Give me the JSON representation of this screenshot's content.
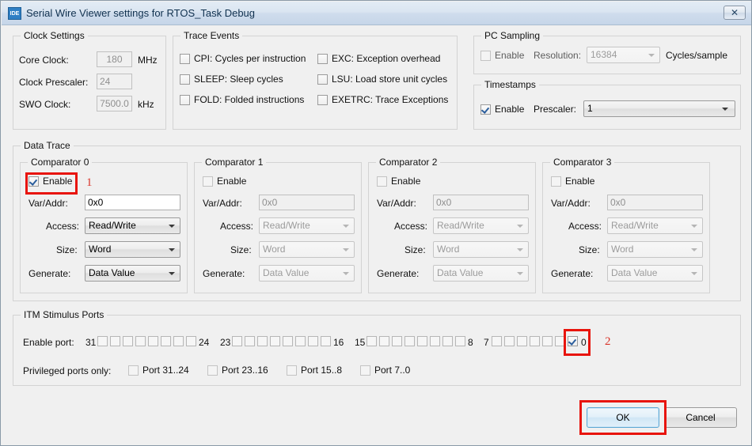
{
  "window": {
    "title": "Serial Wire Viewer settings for RTOS_Task Debug",
    "icon_label": "IDE",
    "close_glyph": "✕",
    "close_icon_name": "close-icon"
  },
  "clock_settings": {
    "title": "Clock Settings",
    "core_clock": {
      "label": "Core Clock:",
      "value": "180",
      "unit": "MHz"
    },
    "clock_prescaler": {
      "label": "Clock Prescaler:",
      "value": "24"
    },
    "swo_clock": {
      "label": "SWO Clock:",
      "value": "7500.0",
      "unit": "kHz"
    }
  },
  "trace_events": {
    "title": "Trace Events",
    "items": [
      {
        "label": "CPI: Cycles per instruction",
        "checked": false
      },
      {
        "label": "EXC: Exception overhead",
        "checked": false
      },
      {
        "label": "SLEEP: Sleep cycles",
        "checked": false
      },
      {
        "label": "LSU: Load store unit cycles",
        "checked": false
      },
      {
        "label": "FOLD: Folded instructions",
        "checked": false
      },
      {
        "label": "EXETRC: Trace Exceptions",
        "checked": false
      }
    ]
  },
  "pc_sampling": {
    "title": "PC Sampling",
    "enable_label": "Enable",
    "enabled": false,
    "resolution_label": "Resolution:",
    "resolution_value": "16384",
    "cycles_label": "Cycles/sample"
  },
  "timestamps": {
    "title": "Timestamps",
    "enable_label": "Enable",
    "enabled": true,
    "prescaler_label": "Prescaler:",
    "prescaler_value": "1"
  },
  "data_trace": {
    "title": "Data Trace",
    "field_labels": {
      "var_addr": "Var/Addr:",
      "access": "Access:",
      "size": "Size:",
      "generate": "Generate:",
      "enable": "Enable"
    },
    "comparators": [
      {
        "title": "Comparator 0",
        "enabled": true,
        "var_addr": "0x0",
        "access": "Read/Write",
        "size": "Word",
        "generate": "Data Value"
      },
      {
        "title": "Comparator 1",
        "enabled": false,
        "var_addr": "0x0",
        "access": "Read/Write",
        "size": "Word",
        "generate": "Data Value"
      },
      {
        "title": "Comparator 2",
        "enabled": false,
        "var_addr": "0x0",
        "access": "Read/Write",
        "size": "Word",
        "generate": "Data Value"
      },
      {
        "title": "Comparator 3",
        "enabled": false,
        "var_addr": "0x0",
        "access": "Read/Write",
        "size": "Word",
        "generate": "Data Value"
      }
    ]
  },
  "itm_stimulus_ports": {
    "title": "ITM Stimulus Ports",
    "enable_port_label": "Enable port:",
    "port_groups": [
      {
        "high": "31",
        "low": "24",
        "checked": [
          false,
          false,
          false,
          false,
          false,
          false,
          false,
          false
        ]
      },
      {
        "high": "23",
        "low": "16",
        "checked": [
          false,
          false,
          false,
          false,
          false,
          false,
          false,
          false
        ]
      },
      {
        "high": "15",
        "low": "8",
        "checked": [
          false,
          false,
          false,
          false,
          false,
          false,
          false,
          false
        ]
      },
      {
        "high": "7",
        "low": "0",
        "checked": [
          false,
          false,
          false,
          false,
          false,
          false,
          false,
          true
        ]
      }
    ],
    "privileged_label": "Privileged ports only:",
    "privileged": [
      {
        "label": "Port 31..24",
        "checked": false
      },
      {
        "label": "Port 23..16",
        "checked": false
      },
      {
        "label": "Port 15..8",
        "checked": false
      },
      {
        "label": "Port 7..0",
        "checked": false
      }
    ]
  },
  "footer": {
    "ok_label": "OK",
    "cancel_label": "Cancel"
  },
  "annotations": {
    "accent_color": "#e8140c",
    "number_color": "#d93328",
    "marks": [
      {
        "number": "1",
        "target": "comparator-0-enable-checkbox"
      },
      {
        "number": "2",
        "target": "itm-port-0-checkbox"
      }
    ]
  }
}
